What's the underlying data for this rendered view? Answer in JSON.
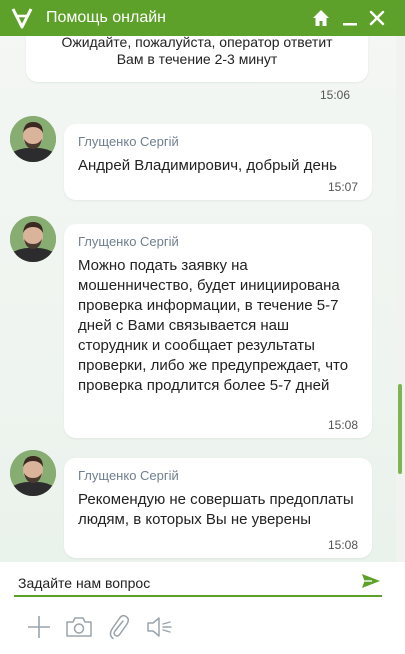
{
  "window": {
    "title": "Помощь онлайн",
    "accent_color": "#5ea12a",
    "icons": [
      "logo-icon",
      "home-icon",
      "minimize-icon",
      "close-icon"
    ]
  },
  "system_message": {
    "line1": "Ожидайте, пожалуйста, оператор ответит",
    "line2": "Вам в течение 2-3 минут",
    "time": "15:06"
  },
  "messages": [
    {
      "sender": "Глущенко Сергій",
      "text": "Андрей Владимирович, добрый день",
      "time": "15:07"
    },
    {
      "sender": "Глущенко Сергій",
      "text": "Можно подать заявку на мошенничество, будет инициирована проверка информации, в течение 5-7 дней с Вами связывается наш сторудник и сообщает результаты проверки, либо же предупреждает, что проверка продлится более 5-7 дней",
      "time": "15:08"
    },
    {
      "sender": "Глущенко Сергій",
      "text": "Рекомендую не совершать предоплаты людям, в которых Вы не уверены",
      "time": "15:08"
    }
  ],
  "composer": {
    "placeholder": "Задайте нам вопрос",
    "value": "",
    "tools": [
      "plus-icon",
      "camera-icon",
      "paperclip-icon",
      "speaker-icon"
    ]
  }
}
